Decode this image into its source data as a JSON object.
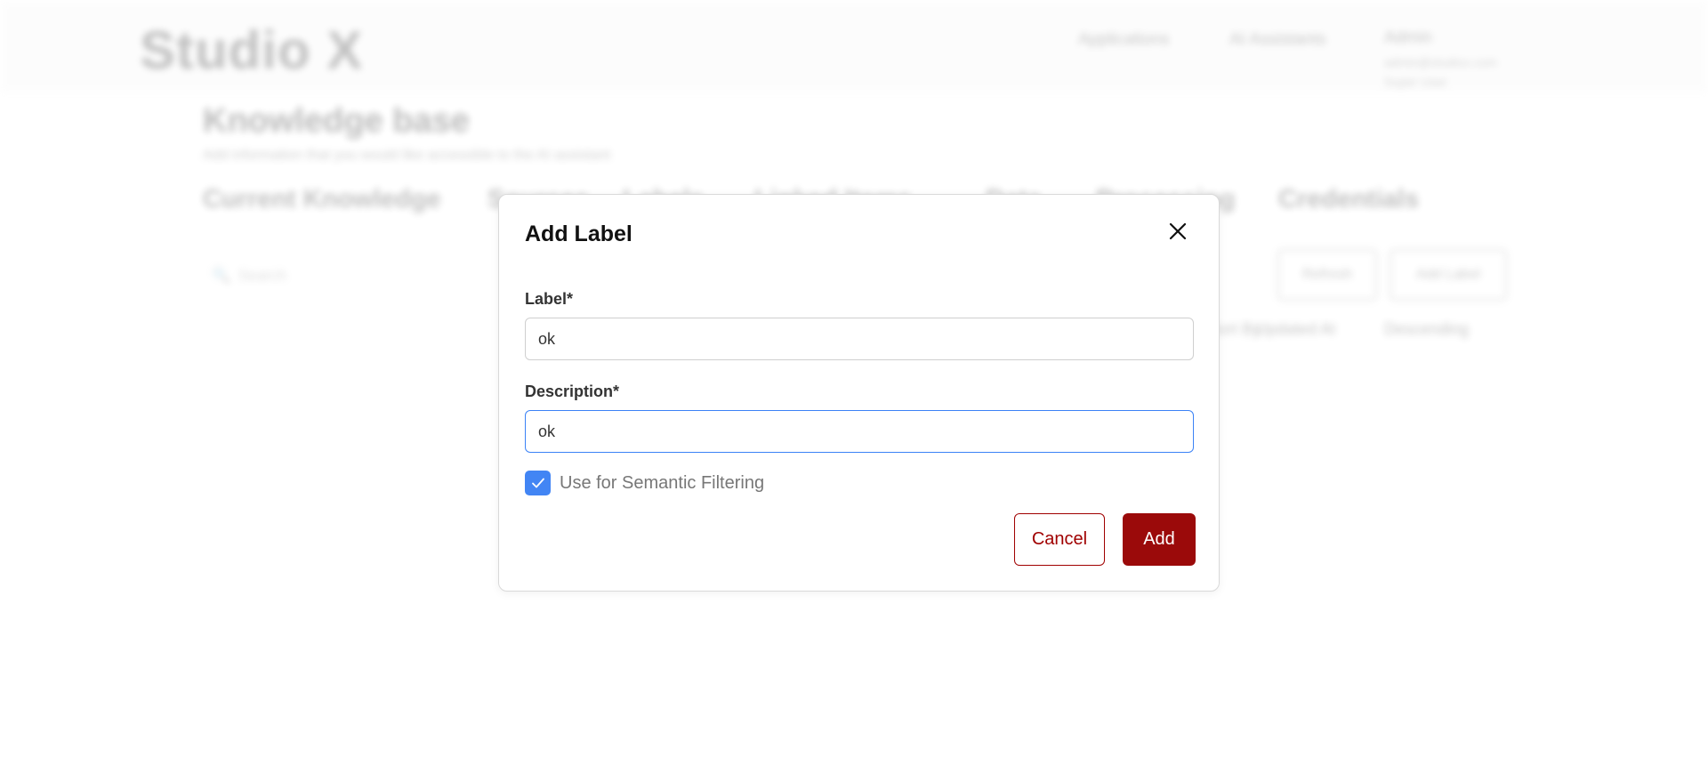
{
  "background": {
    "logo": "Studio X",
    "nav": [
      "Applications",
      "AI Assistants"
    ],
    "user": {
      "name": "Admin",
      "email": "admin@studiox.com",
      "role": "Super User"
    },
    "title": "Knowledge base",
    "subtitle": "Add information that you would like accessible to the AI assistant",
    "tabs": [
      "Current Knowledge",
      "Sources",
      "Labels",
      "Linked Items",
      "Data",
      "Processing",
      "Credentials"
    ],
    "search_placeholder": "Search",
    "buttons": [
      "Refresh",
      "Add Label"
    ],
    "sort": {
      "by_label": "Sort By:",
      "by_value": "Updated At",
      "order": "Descending"
    }
  },
  "modal": {
    "title": "Add Label",
    "label_field": {
      "label": "Label*",
      "value": "ok"
    },
    "description_field": {
      "label": "Description*",
      "value": "ok"
    },
    "checkbox": {
      "label": "Use for Semantic Filtering",
      "checked": true
    },
    "cancel_label": "Cancel",
    "add_label": "Add"
  },
  "colors": {
    "primary": "#9b0a0a",
    "focus_border": "#3b82f6",
    "checkbox": "#4285f4"
  }
}
